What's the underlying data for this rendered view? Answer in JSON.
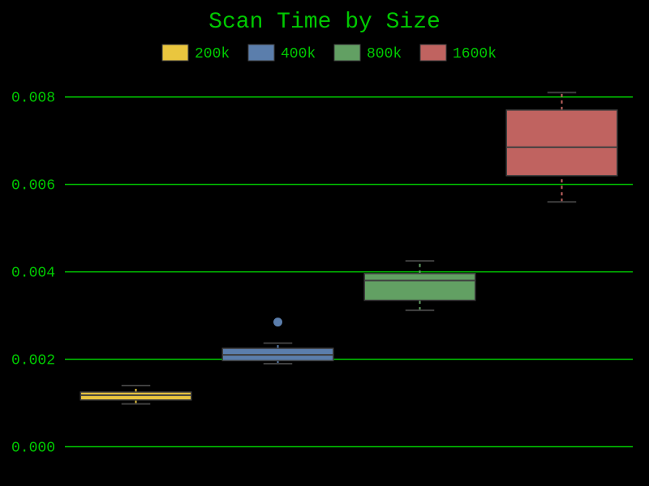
{
  "chart_data": {
    "type": "boxplot",
    "title": "Scan Time by Size",
    "xlabel": "",
    "ylabel": "",
    "ylim": [
      -0.00025,
      0.00855
    ],
    "y_ticks": [
      0.0,
      0.002,
      0.004,
      0.006,
      0.008
    ],
    "y_tick_labels": [
      "0.000",
      "0.002",
      "0.004",
      "0.006",
      "0.008"
    ],
    "categories": [
      "200k",
      "400k",
      "800k",
      "1600k"
    ],
    "series": [
      {
        "name": "200k",
        "color": "#eac63e",
        "whisker_low": 0.00098,
        "q1": 0.00107,
        "median": 0.00118,
        "q3": 0.00125,
        "whisker_high": 0.0014,
        "outliers": []
      },
      {
        "name": "400k",
        "color": "#5b7eac",
        "whisker_low": 0.0019,
        "q1": 0.00197,
        "median": 0.0021,
        "q3": 0.00225,
        "whisker_high": 0.00237,
        "outliers": [
          0.00285
        ]
      },
      {
        "name": "800k",
        "color": "#62a063",
        "whisker_low": 0.00312,
        "q1": 0.00335,
        "median": 0.0038,
        "q3": 0.00396,
        "whisker_high": 0.00425,
        "outliers": []
      },
      {
        "name": "1600k",
        "color": "#c06360",
        "whisker_low": 0.0056,
        "q1": 0.0062,
        "median": 0.00685,
        "q3": 0.0077,
        "whisker_high": 0.0081,
        "outliers": []
      }
    ]
  },
  "legend": {
    "items": [
      {
        "label": "200k",
        "color": "#eac63e"
      },
      {
        "label": "400k",
        "color": "#5b7eac"
      },
      {
        "label": "800k",
        "color": "#62a063"
      },
      {
        "label": "1600k",
        "color": "#c06360"
      }
    ]
  }
}
